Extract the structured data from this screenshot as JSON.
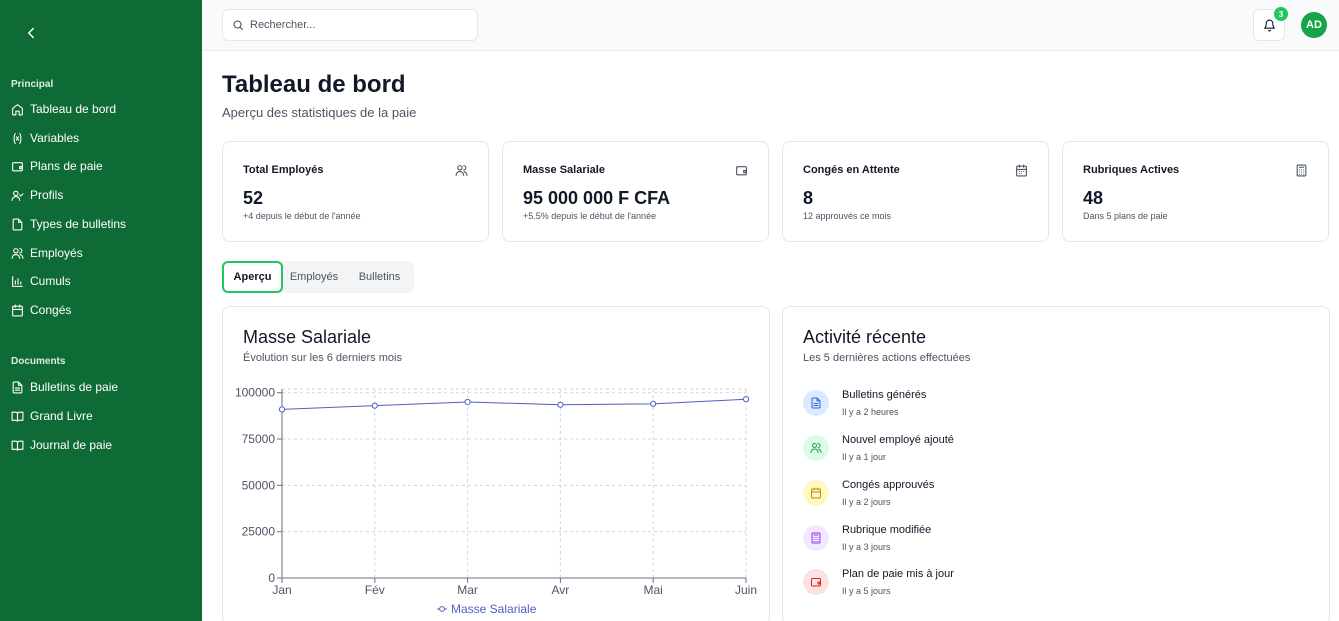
{
  "sidebar": {
    "sections": [
      {
        "label": "Principal",
        "items": [
          {
            "label": "Tableau de bord",
            "icon": "home-icon"
          },
          {
            "label": "Variables",
            "icon": "variable-icon"
          },
          {
            "label": "Plans de paie",
            "icon": "wallet-icon"
          },
          {
            "label": "Profils",
            "icon": "user-check-icon"
          },
          {
            "label": "Types de bulletins",
            "icon": "file-icon"
          },
          {
            "label": "Employés",
            "icon": "users-icon"
          },
          {
            "label": "Cumuls",
            "icon": "bar-chart-icon"
          },
          {
            "label": "Congés",
            "icon": "calendar-icon"
          }
        ]
      },
      {
        "label": "Documents",
        "items": [
          {
            "label": "Bulletins de paie",
            "icon": "file-text-icon"
          },
          {
            "label": "Grand Livre",
            "icon": "book-icon"
          },
          {
            "label": "Journal de paie",
            "icon": "book-open-icon"
          }
        ]
      }
    ]
  },
  "header": {
    "search_placeholder": "Rechercher...",
    "notification_count": "3",
    "avatar_initials": "AD"
  },
  "page": {
    "title": "Tableau de bord",
    "subtitle": "Aperçu des statistiques de la paie"
  },
  "stats": [
    {
      "title": "Total Employés",
      "value": "52",
      "note": "+4 depuis le début de l'année",
      "icon": "users-icon"
    },
    {
      "title": "Masse Salariale",
      "value": "95 000 000 F CFA",
      "note": "+5.5% depuis le début de l'année",
      "icon": "wallet-icon"
    },
    {
      "title": "Congés en Attente",
      "value": "8",
      "note": "12 approuvés ce mois",
      "icon": "calendar-icon"
    },
    {
      "title": "Rubriques Actives",
      "value": "48",
      "note": "Dans 5 plans de paie",
      "icon": "calculator-icon"
    }
  ],
  "tabs": [
    {
      "label": "Aperçu",
      "active": true
    },
    {
      "label": "Employés",
      "active": false
    },
    {
      "label": "Bulletins",
      "active": false
    }
  ],
  "salary_panel": {
    "title": "Masse Salariale",
    "subtitle": "Évolution sur les 6 derniers mois"
  },
  "chart_data": {
    "type": "line",
    "categories": [
      "Jan",
      "Fév",
      "Mar",
      "Avr",
      "Mai",
      "Juin"
    ],
    "series": [
      {
        "name": "Masse Salariale",
        "values": [
          91000,
          93000,
          95000,
          93500,
          94000,
          96500
        ],
        "color": "#4f5fc4"
      }
    ],
    "yticks": [
      0,
      25000,
      50000,
      75000,
      100000
    ],
    "ylim": [
      0,
      102000
    ],
    "grid": true,
    "legend": "bottom"
  },
  "activity_panel": {
    "title": "Activité récente",
    "subtitle": "Les 5 dernières actions effectuées",
    "items": [
      {
        "title": "Bulletins générés",
        "time": "Il y a 2 heures",
        "icon": "file-text-icon",
        "bg": "#dbeafe",
        "fg": "#2563eb"
      },
      {
        "title": "Nouvel employé ajouté",
        "time": "Il y a 1 jour",
        "icon": "users-icon",
        "bg": "#dcfce7",
        "fg": "#16a34a"
      },
      {
        "title": "Congés approuvés",
        "time": "Il y a 2 jours",
        "icon": "calendar-icon",
        "bg": "#fef9c3",
        "fg": "#ca8a04"
      },
      {
        "title": "Rubrique modifiée",
        "time": "Il y a 3 jours",
        "icon": "calculator-icon",
        "bg": "#f3e8ff",
        "fg": "#9333ea"
      },
      {
        "title": "Plan de paie mis à jour",
        "time": "Il y a 5 jours",
        "icon": "wallet-icon",
        "bg": "#fee2e2",
        "fg": "#dc2626"
      }
    ]
  }
}
